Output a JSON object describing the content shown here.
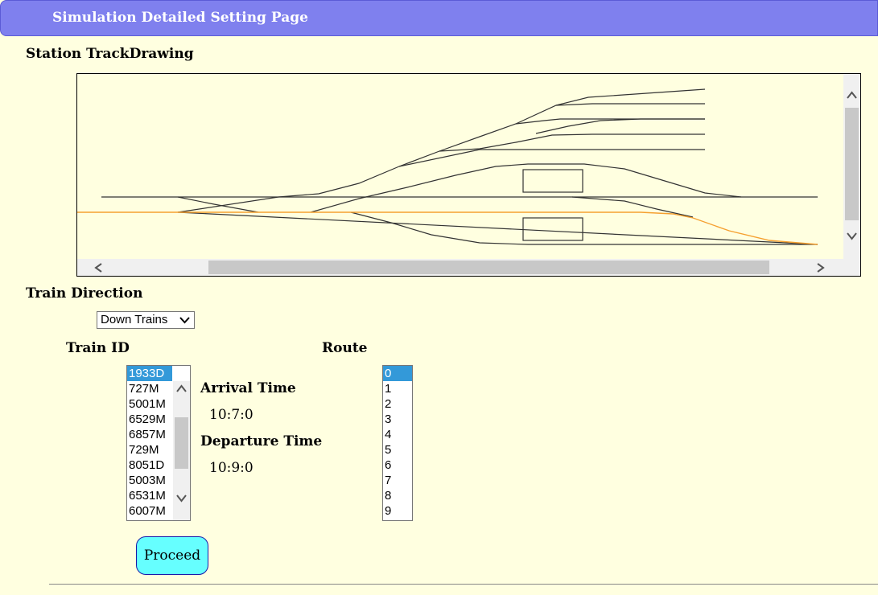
{
  "header": {
    "title": "Simulation Detailed Setting Page"
  },
  "track_drawing": {
    "label": "Station TrackDrawing",
    "highlight_color": "#f5a030",
    "track_color": "#333333"
  },
  "train_direction": {
    "label": "Train Direction",
    "selected": "Down Trains"
  },
  "train_id": {
    "label": "Train ID",
    "items": [
      "1933D",
      "727M",
      "5001M",
      "6529M",
      "6857M",
      "729M",
      "8051D",
      "5003M",
      "6531M",
      "6007M"
    ],
    "selected_index": 0
  },
  "times": {
    "arrival_label": "Arrival Time",
    "arrival_value": "10:7:0",
    "departure_label": "Departure Time",
    "departure_value": "10:9:0"
  },
  "route": {
    "label": "Route",
    "items": [
      "0",
      "1",
      "2",
      "3",
      "4",
      "5",
      "6",
      "7",
      "8",
      "9"
    ],
    "selected_index": 0
  },
  "actions": {
    "proceed_label": "Proceed"
  },
  "icons": [
    "chevron-up-icon",
    "chevron-down-icon",
    "chevron-left-icon",
    "chevron-right-icon",
    "dropdown-arrow-icon"
  ]
}
